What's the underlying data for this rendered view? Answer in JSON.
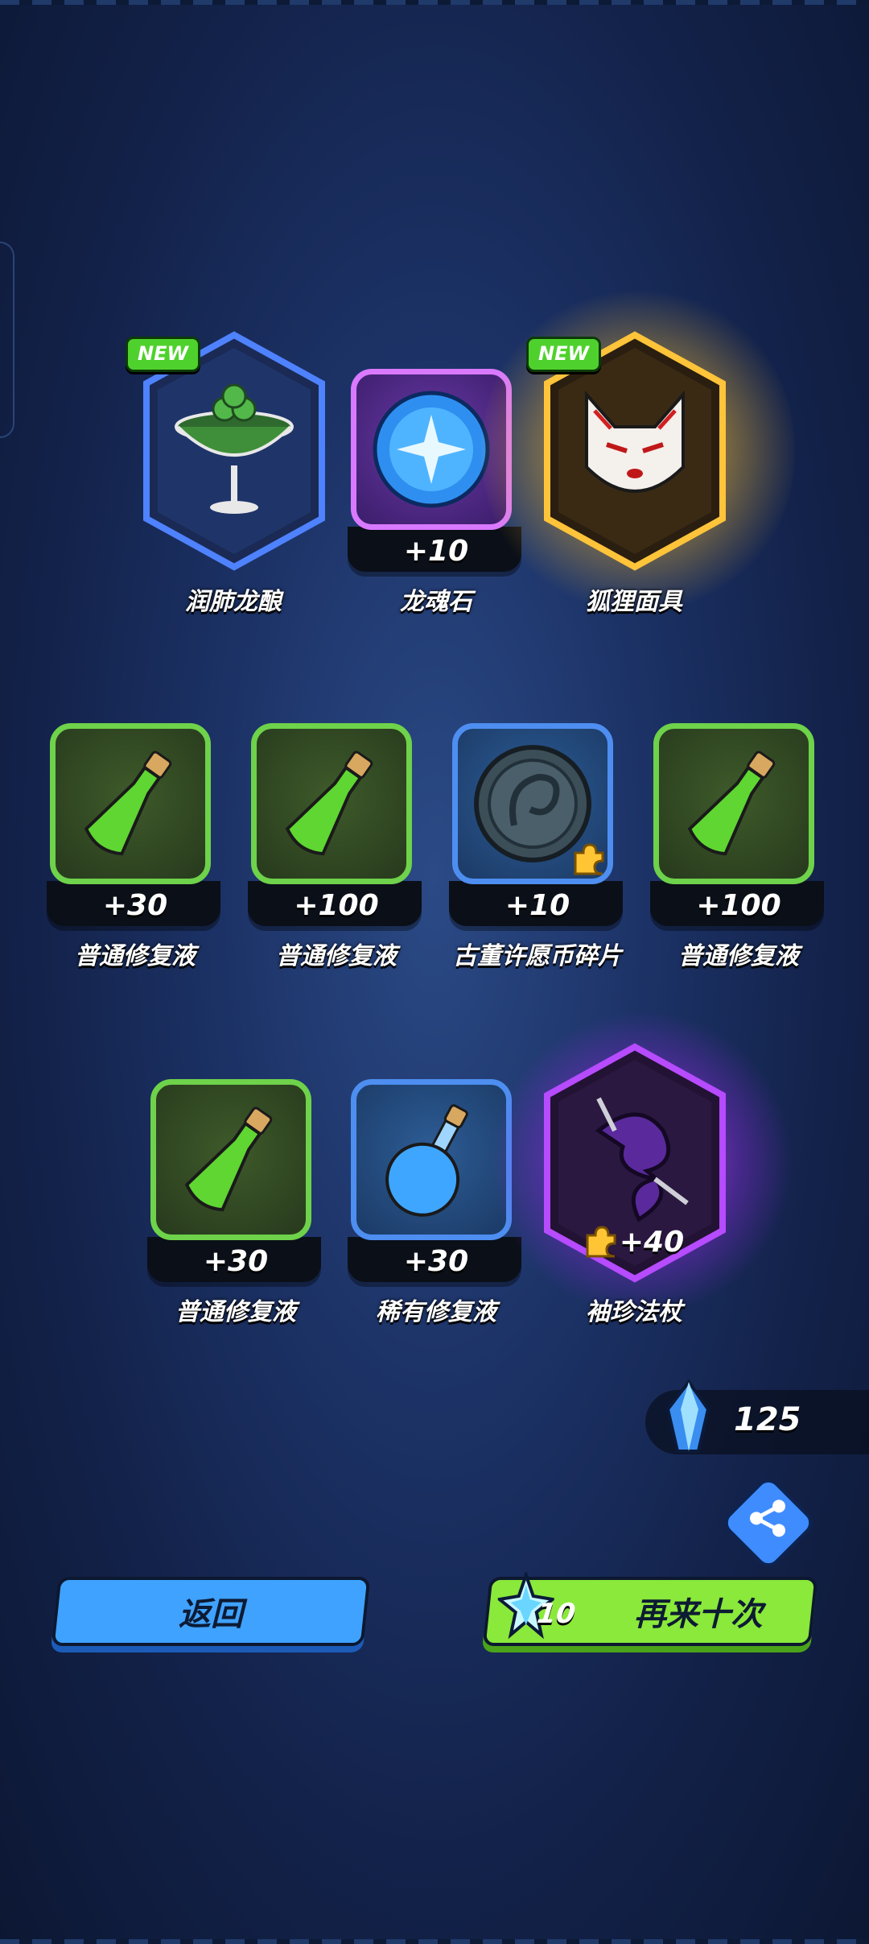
{
  "row1": [
    {
      "name": "润肺龙酿",
      "badge": "NEW",
      "frame": "blue-hex"
    },
    {
      "name": "龙魂石",
      "qty": "+10",
      "frame": "purple"
    },
    {
      "name": "狐狸面具",
      "badge": "NEW",
      "frame": "gold-hex"
    }
  ],
  "row2": [
    {
      "name": "普通修复液",
      "qty": "+30",
      "frame": "green"
    },
    {
      "name": "普通修复液",
      "qty": "+100",
      "frame": "green"
    },
    {
      "name": "古董许愿币碎片",
      "qty": "+10",
      "frame": "blue"
    },
    {
      "name": "普通修复液",
      "qty": "+100",
      "frame": "green"
    }
  ],
  "row3": [
    {
      "name": "普通修复液",
      "qty": "+30",
      "frame": "green"
    },
    {
      "name": "稀有修复液",
      "qty": "+30",
      "frame": "blue"
    },
    {
      "name": "袖珍法杖",
      "qty": "+40",
      "frame": "purple-hex"
    }
  ],
  "currency": {
    "amount": "125",
    "icon": "crystal-icon"
  },
  "buttons": {
    "back": "返回",
    "again": "再来十次",
    "again_cost": "10"
  },
  "icons": {
    "share": "share-icon"
  }
}
